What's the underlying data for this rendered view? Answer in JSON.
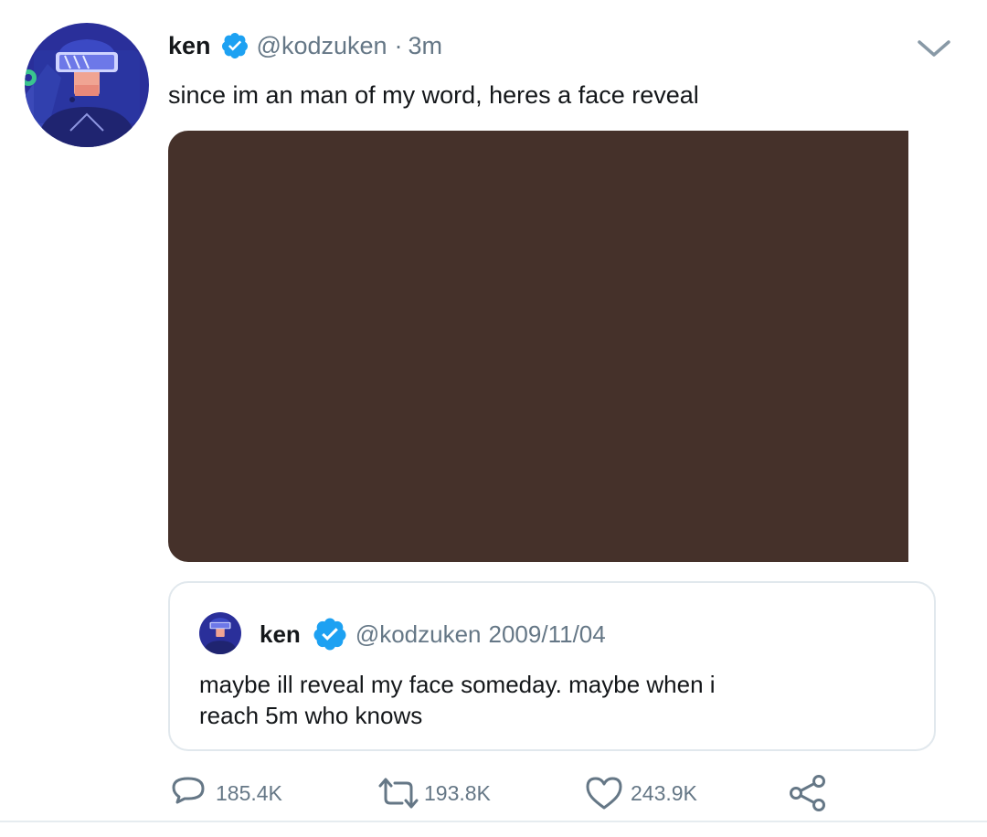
{
  "tweet": {
    "author_name": "ken",
    "author_handle": "@kodzuken",
    "separator": "·",
    "time_ago": "3m",
    "text": "since im an man of my word, heres a face reveal",
    "media_color": "#45312a"
  },
  "quoted_tweet": {
    "author_name": "ken",
    "author_handle": "@kodzuken",
    "date": "2009/11/04",
    "text": "maybe ill reveal my face someday. maybe when i\nreach 5m who knows"
  },
  "actions": {
    "reply_count": "185.4K",
    "retweet_count": "193.8K",
    "like_count": "243.9K"
  },
  "icons": {
    "verified": "verified-badge-icon",
    "caret": "chevron-down-icon",
    "reply": "reply-bubble-icon",
    "retweet": "retweet-icon",
    "like": "heart-icon",
    "share": "share-icon"
  },
  "colors": {
    "verified_blue": "#1da1f2",
    "muted_text": "#657786",
    "icon_gray": "#657786",
    "border": "#e1e8ed"
  }
}
